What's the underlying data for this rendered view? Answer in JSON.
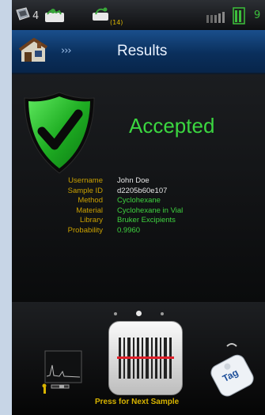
{
  "status_bar": {
    "count": "4",
    "indicator_small": "(14)",
    "right_text": "9"
  },
  "header": {
    "chevrons": "›››",
    "title": "Results"
  },
  "result": {
    "status": "Accepted",
    "status_color": "#3bd640",
    "details": [
      {
        "label": "Username",
        "value": "John Doe",
        "highlight": false
      },
      {
        "label": "Sample ID",
        "value": "d2205b60e107",
        "highlight": false
      },
      {
        "label": "Method",
        "value": "Cyclohexane",
        "highlight": true
      },
      {
        "label": "Material",
        "value": "Cyclohexane in Vial",
        "highlight": true
      },
      {
        "label": "Library",
        "value": "Bruker Excipients",
        "highlight": true
      },
      {
        "label": "Probability",
        "value": "0.9960",
        "highlight": true
      }
    ]
  },
  "bottom": {
    "press_label": "Press for Next Sample",
    "tag_label": "Tag",
    "page_indicator": {
      "count": 3,
      "active": 1
    }
  },
  "colors": {
    "accent_green": "#3bd640",
    "label_gold": "#c9a000",
    "header_blue": "#0a2f5c"
  }
}
